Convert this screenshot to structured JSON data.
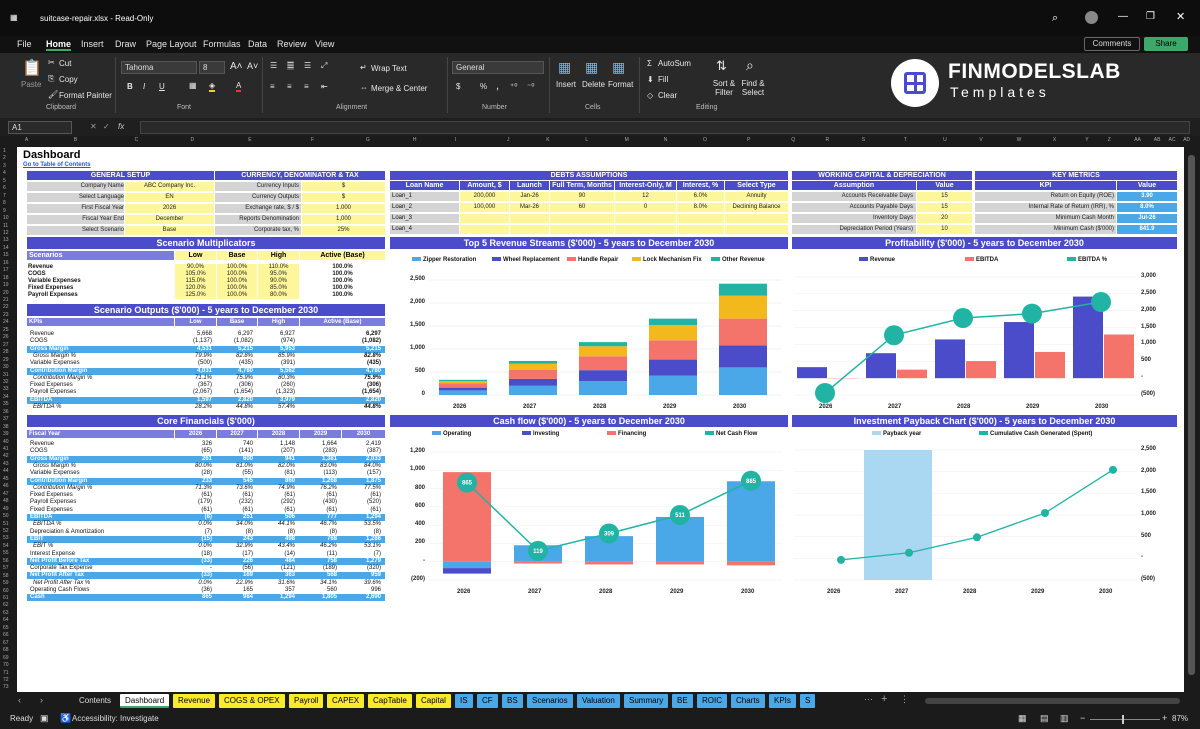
{
  "window": {
    "title": "suitcase-repair.xlsx - Read-Only"
  },
  "menu": [
    "File",
    "Home",
    "Insert",
    "Draw",
    "Page Layout",
    "Formulas",
    "Data",
    "Review",
    "View"
  ],
  "menu_right": {
    "comments": "Comments",
    "share": "Share"
  },
  "ribbon": {
    "paste": "Paste",
    "cut": "Cut",
    "copy": "Copy",
    "format_painter": "Format Painter",
    "clipboard": "Clipboard",
    "font_name": "Tahoma",
    "font_size": "8",
    "font": "Font",
    "wrap_text": "Wrap Text",
    "merge_center": "Merge & Center",
    "alignment": "Alignment",
    "number_format": "General",
    "number": "Number",
    "insert": "Insert",
    "delete": "Delete",
    "format": "Format",
    "cells": "Cells",
    "autosum": "AutoSum",
    "fill": "Fill",
    "clear": "Clear",
    "sort_filter": "Sort & Filter",
    "find_select": "Find & Select",
    "editing": "Editing",
    "bold": "B",
    "italic": "I",
    "underline": "U",
    "percent": "%",
    "comma": ","
  },
  "logo": {
    "name": "FINMODELSLAB",
    "sub": "Templates"
  },
  "formula_bar": {
    "cell_ref": "A1",
    "fx": "fx"
  },
  "columns": [
    "A",
    "B",
    "C",
    "D",
    "E",
    "F",
    "G",
    "H",
    "I",
    "J",
    "K",
    "L",
    "M",
    "N",
    "O",
    "P",
    "Q",
    "R",
    "S",
    "T",
    "U",
    "V",
    "W",
    "X",
    "Y",
    "Z",
    "AA",
    "AB",
    "AC",
    "AD"
  ],
  "rows": [
    "1",
    "2",
    "3",
    "4",
    "5",
    "6",
    "7",
    "8",
    "9",
    "10",
    "11",
    "12",
    "13",
    "14",
    "15",
    "16",
    "17",
    "18",
    "19",
    "20",
    "21",
    "22",
    "23",
    "24",
    "25",
    "26",
    "27",
    "28",
    "29",
    "30",
    "31",
    "32",
    "33",
    "34",
    "35",
    "36",
    "37",
    "38",
    "39",
    "40",
    "41",
    "42",
    "43",
    "44",
    "45",
    "46",
    "47",
    "48",
    "49",
    "50",
    "51",
    "52",
    "53",
    "54",
    "55",
    "56",
    "57",
    "58",
    "59",
    "60",
    "61",
    "62",
    "63",
    "64",
    "65",
    "66",
    "67",
    "68",
    "69",
    "70",
    "71",
    "72",
    "73"
  ],
  "dashboard": {
    "title": "Dashboard",
    "toc_link": "Go to Table of Contents"
  },
  "general_setup": {
    "header": "GENERAL SETUP",
    "rows": [
      [
        "Company Name",
        "ABC Company Inc."
      ],
      [
        "Select Language",
        "EN"
      ],
      [
        "First Fiscal Year",
        "2026"
      ],
      [
        "Fiscal Year End",
        "December"
      ],
      [
        "Select Scenario",
        "Base"
      ]
    ]
  },
  "currency": {
    "header": "CURRENCY, DENOMINATOR & TAX",
    "rows": [
      [
        "Currency Inputs",
        "$"
      ],
      [
        "Currency Outputs",
        "$"
      ],
      [
        "Exchange rate, $ / $",
        "1.000"
      ],
      [
        "Reports Denomination",
        "1,000"
      ],
      [
        "Corporate tax, %",
        "25%"
      ]
    ]
  },
  "debts": {
    "header": "DEBTS ASSUMPTIONS",
    "cols": [
      "Loan Name",
      "Amount, $",
      "Launch",
      "Full Term, Months",
      "Interest-Only, M",
      "Interest, %",
      "Select Type"
    ],
    "rows": [
      [
        "Loan_1",
        "200,000",
        "Jan-26",
        "90",
        "12",
        "6.0%",
        "Annuity"
      ],
      [
        "Loan_2",
        "100,000",
        "Mar-26",
        "60",
        "0",
        "8.0%",
        "Declining Balance"
      ],
      [
        "Loan_3",
        "",
        "",
        "",
        "",
        "",
        ""
      ],
      [
        "Loan_4",
        "",
        "",
        "",
        "",
        "",
        ""
      ]
    ]
  },
  "working_capital": {
    "header": "WORKING CAPITAL & DEPRECIATION",
    "cols": [
      "Assumption",
      "Value"
    ],
    "rows": [
      [
        "Accounts Receivable Days",
        "15"
      ],
      [
        "Accounts Payable Days",
        "15"
      ],
      [
        "Inventory Days",
        "20"
      ],
      [
        "Depreciation Period (Years)",
        "10"
      ]
    ]
  },
  "key_metrics": {
    "header": "KEY METRICS",
    "cols": [
      "KPI",
      "Value"
    ],
    "rows": [
      [
        "Return on Equity (ROE)",
        "3.90"
      ],
      [
        "Internal Rate of Return (IRR), %",
        "8.0%"
      ],
      [
        "Minimum Cash Month",
        "Jul-26"
      ],
      [
        "Minimum Cash ($'000)",
        "841.9"
      ]
    ]
  },
  "scenario_mult": {
    "title": "Scenario Multiplicators",
    "cols": [
      "Scenarios",
      "Low",
      "Base",
      "High",
      "Active (Base)"
    ],
    "rows": [
      [
        "Revenue",
        "90.0%",
        "100.0%",
        "110.0%",
        "100.0%"
      ],
      [
        "COGS",
        "105.0%",
        "100.0%",
        "95.0%",
        "100.0%"
      ],
      [
        "Variable Expenses",
        "115.0%",
        "100.0%",
        "90.0%",
        "100.0%"
      ],
      [
        "Fixed Expenses",
        "120.0%",
        "100.0%",
        "85.0%",
        "100.0%"
      ],
      [
        "Payroll Expenses",
        "125.0%",
        "100.0%",
        "80.0%",
        "100.0%"
      ]
    ]
  },
  "scenario_out": {
    "title": "Scenario Outputs ($'000) - 5 years to December 2030",
    "cols": [
      "KPIs",
      "Low",
      "Base",
      "High",
      "Active (Base)"
    ],
    "rows": [
      [
        "Revenue",
        "5,668",
        "6,297",
        "6,927",
        "6,297",
        ""
      ],
      [
        "COGS",
        "(1,137)",
        "(1,082)",
        "(974)",
        "(1,082)",
        ""
      ],
      [
        "Gross Margin",
        "4,531",
        "5,215",
        "5,953",
        "5,215",
        "h"
      ],
      [
        "Gross Margin %",
        "79.9%",
        "82.8%",
        "85.9%",
        "82.8%",
        "i"
      ],
      [
        "Variable Expenses",
        "(500)",
        "(435)",
        "(391)",
        "(435)",
        ""
      ],
      [
        "Contribution Margin",
        "4,031",
        "4,780",
        "5,562",
        "4,780",
        "h"
      ],
      [
        "Contribution Margin %",
        "71.1%",
        "75.9%",
        "80.3%",
        "75.9%",
        "i"
      ],
      [
        "Fixed Expenses",
        "(367)",
        "(306)",
        "(260)",
        "(306)",
        ""
      ],
      [
        "Payroll Expenses",
        "(2,067)",
        "(1,654)",
        "(1,323)",
        "(1,654)",
        ""
      ],
      [
        "EBITDA",
        "1,597",
        "2,820",
        "3,979",
        "2,820",
        "h"
      ],
      [
        "EBITDA %",
        "28.2%",
        "44.8%",
        "57.4%",
        "44.8%",
        "i"
      ]
    ]
  },
  "core": {
    "title": "Core Financials ($'000)",
    "cols": [
      "Fiscal Year",
      "2026",
      "2027",
      "2028",
      "2029",
      "2030"
    ],
    "rows": [
      [
        "Revenue",
        "326",
        "740",
        "1,148",
        "1,664",
        "2,419",
        ""
      ],
      [
        "COGS",
        "(65)",
        "(141)",
        "(207)",
        "(283)",
        "(387)",
        ""
      ],
      [
        "Gross Margin",
        "261",
        "600",
        "941",
        "1,381",
        "2,033",
        "h"
      ],
      [
        "Gross Margin %",
        "80.0%",
        "81.0%",
        "82.0%",
        "83.0%",
        "84.0%",
        "i"
      ],
      [
        "Variable Expenses",
        "(28)",
        "(55)",
        "(81)",
        "(113)",
        "(157)",
        ""
      ],
      [
        "Contribution Margin",
        "233",
        "545",
        "860",
        "1,268",
        "1,875",
        "h"
      ],
      [
        "Contribution Margin %",
        "71.3%",
        "73.6%",
        "74.9%",
        "76.2%",
        "77.5%",
        "i"
      ],
      [
        "Fixed Expenses",
        "(61)",
        "(61)",
        "(61)",
        "(61)",
        "(61)",
        ""
      ],
      [
        "Payroll Expenses",
        "(179)",
        "(232)",
        "(292)",
        "(430)",
        "(520)",
        ""
      ],
      [
        "Fixed Expenses",
        "(61)",
        "(61)",
        "(61)",
        "(61)",
        "(61)",
        ""
      ],
      [
        "EBITDA",
        "(8)",
        "251",
        "506",
        "777",
        "1,294",
        "h"
      ],
      [
        "EBITDA %",
        "0.0%",
        "34.0%",
        "44.1%",
        "46.7%",
        "53.5%",
        "i"
      ],
      [
        "Depreciation & Amortization",
        "(7)",
        "(8)",
        "(8)",
        "(8)",
        "(8)",
        ""
      ],
      [
        "EBIT",
        "(15)",
        "243",
        "498",
        "768",
        "1,286",
        "h"
      ],
      [
        "EBIT %",
        "0.0%",
        "32.9%",
        "43.4%",
        "46.2%",
        "53.1%",
        "i"
      ],
      [
        "Interest Expense",
        "(18)",
        "(17)",
        "(14)",
        "(11)",
        "(7)",
        ""
      ],
      [
        "Net Profit Before Tax",
        "(33)",
        "226",
        "484",
        "758",
        "1,279",
        "h"
      ],
      [
        "Corporate Tax Expense",
        "-",
        "(56)",
        "(121)",
        "(189)",
        "(320)",
        ""
      ],
      [
        "Net Profit After Tax",
        "(33)",
        "169",
        "363",
        "568",
        "959",
        "h"
      ],
      [
        "Net Profit After Tax %",
        "0.0%",
        "22.9%",
        "31.6%",
        "34.1%",
        "39.6%",
        "i"
      ],
      [
        "Operating Cash Flows",
        "(36)",
        "165",
        "357",
        "560",
        "996",
        ""
      ],
      [
        "Cash",
        "865",
        "984",
        "1,294",
        "1,805",
        "2,690",
        "h"
      ]
    ]
  },
  "chart_rev": {
    "title": "Top 5 Revenue Streams ($'000) - 5 years to December 2030",
    "type": "bar",
    "categories": [
      "2026",
      "2027",
      "2028",
      "2029",
      "2030"
    ],
    "series": [
      {
        "name": "Zipper Restoration",
        "values": [
          100,
          200,
          300,
          420,
          600
        ]
      },
      {
        "name": "Wheel Replacement",
        "values": [
          60,
          150,
          240,
          350,
          480
        ]
      },
      {
        "name": "Handle Repair",
        "values": [
          90,
          200,
          300,
          420,
          580
        ]
      },
      {
        "name": "Lock Mechanism Fix",
        "values": [
          50,
          130,
          220,
          330,
          500
        ]
      },
      {
        "name": "Other Revenue",
        "values": [
          30,
          60,
          90,
          140,
          260
        ]
      }
    ],
    "yticks": [
      "0",
      "500",
      "1,000",
      "1,500",
      "2,000",
      "2,500"
    ],
    "ylim": [
      0,
      2500
    ],
    "colors": [
      "#4aa8e8",
      "#4b4cc9",
      "#f4736b",
      "#f3b81c",
      "#21b3a4"
    ]
  },
  "chart_prof": {
    "title": "Profitability ($'000) - 5 years to December 2030",
    "type": "bar",
    "categories": [
      "2026",
      "2027",
      "2028",
      "2029",
      "2030"
    ],
    "series": [
      {
        "name": "Revenue",
        "values": [
          326,
          740,
          1148,
          1664,
          2419
        ]
      },
      {
        "name": "EBITDA",
        "values": [
          -8,
          251,
          506,
          777,
          1294
        ]
      },
      {
        "name": "EBITDA %",
        "values": [
          0.0,
          34.0,
          44.1,
          46.7,
          53.5
        ]
      }
    ],
    "point_labels": [
      "0.0%",
      "34.0%",
      "44.1%",
      "46.7%",
      "53.5%"
    ],
    "yticks_right": [
      "(500)",
      "-",
      "500",
      "1,000",
      "1,500",
      "2,000",
      "2,500",
      "3,000"
    ],
    "ylim": [
      -500,
      3000
    ]
  },
  "chart_cash": {
    "title": "Cash flow ($'000) - 5 years to December 2030",
    "type": "bar",
    "categories": [
      "2026",
      "2027",
      "2028",
      "2029",
      "2030"
    ],
    "series": [
      {
        "name": "Operating",
        "values": [
          -70,
          180,
          280,
          490,
          880
        ]
      },
      {
        "name": "Investing",
        "values": [
          -60,
          0,
          0,
          0,
          0
        ]
      },
      {
        "name": "Financing",
        "values": [
          980,
          -20,
          -30,
          -30,
          -40
        ]
      },
      {
        "name": "Net Cash Flow",
        "values": [
          865,
          119,
          309,
          511,
          885
        ]
      }
    ],
    "yticks": [
      "(200)",
      "-",
      "200",
      "400",
      "600",
      "800",
      "1,000",
      "1,200"
    ],
    "ylim": [
      -200,
      1200
    ]
  },
  "chart_payback": {
    "title": "Investment Payback Chart ($'000) - 5 years to December 2030",
    "type": "line",
    "categories": [
      "2026",
      "2027",
      "2028",
      "2029",
      "2030"
    ],
    "series": [
      {
        "name": "Payback year",
        "values": [
          0,
          1,
          0,
          0,
          0
        ]
      },
      {
        "name": "Cumulative Cash Generated (Spent)",
        "values": [
          -36,
          129,
          486,
          1046,
          2042
        ]
      }
    ],
    "yticks": [
      "(500)",
      "-",
      "500",
      "1,000",
      "1,500",
      "2,000",
      "2,500"
    ],
    "ylim": [
      -500,
      2500
    ]
  },
  "tabs": [
    "Contents",
    "Dashboard",
    "Revenue",
    "COGS & OPEX",
    "Payroll",
    "CAPEX",
    "CapTable",
    "Capital",
    "IS",
    "CF",
    "BS",
    "Scenarios",
    "Valuation",
    "Summary",
    "BE",
    "ROIC",
    "Charts",
    "KPIs",
    "S"
  ],
  "status": {
    "ready": "Ready",
    "accessibility": "Accessibility: Investigate",
    "zoom": "87%"
  }
}
